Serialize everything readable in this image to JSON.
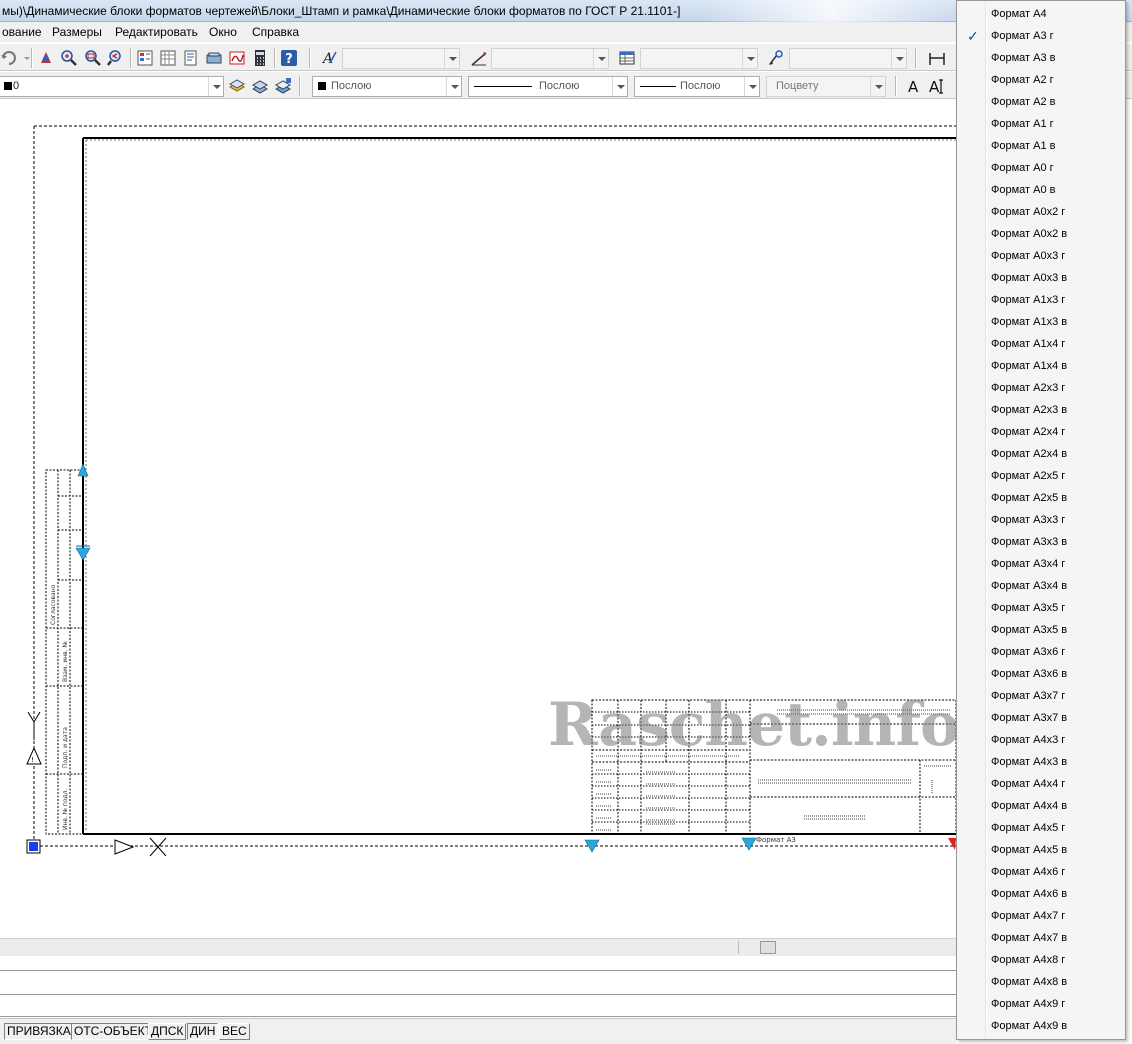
{
  "window": {
    "title": "мы)\\Динамические блоки форматов чертежей\\Блоки_Штамп и рамка\\Динамические блоки форматов по ГОСТ Р 21.1101-]"
  },
  "menu": [
    "ование",
    "Размеры",
    "Редактировать",
    "Окно",
    "Справка"
  ],
  "toolbar2": {
    "layer_value": "0",
    "color_value": "Послою",
    "linetype_value": "Послою",
    "lineweight_value": "Послою",
    "plotstyle_value": "Поцвету"
  },
  "status_buttons": [
    "ПРИВЯЗКА",
    "ОТС-ОБЪЕКТ",
    "ДПСК",
    "ДИН",
    "ВЕС"
  ],
  "watermark": "Raschet.info",
  "dropdown": {
    "selected": "Формат А3 г",
    "items": [
      "Формат А4",
      "Формат А3 г",
      "Формат А3 в",
      "Формат А2 г",
      "Формат А2 в",
      "Формат А1 г",
      "Формат А1 в",
      "Формат А0 г",
      "Формат А0 в",
      "Формат А0х2 г",
      "Формат А0х2 в",
      "Формат А0х3 г",
      "Формат А0х3 в",
      "Формат А1х3 г",
      "Формат А1х3 в",
      "Формат А1х4 г",
      "Формат А1х4 в",
      "Формат А2х3 г",
      "Формат А2х3 в",
      "Формат А2х4 г",
      "Формат А2х4 в",
      "Формат А2х5 г",
      "Формат А2х5 в",
      "Формат А3х3 г",
      "Формат А3х3 в",
      "Формат А3х4 г",
      "Формат А3х4 в",
      "Формат А3х5 г",
      "Формат А3х5 в",
      "Формат А3х6 г",
      "Формат А3х6 в",
      "Формат А3х7 г",
      "Формат А3х7 в",
      "Формат А4х3 г",
      "Формат А4х3 в",
      "Формат А4х4 г",
      "Формат А4х4 в",
      "Формат А4х5 г",
      "Формат А4х5 в",
      "Формат А4х6 г",
      "Формат А4х6 в",
      "Формат А4х7 г",
      "Формат А4х7 в",
      "Формат А4х8 г",
      "Формат А4х8 в",
      "Формат А4х9 г",
      "Формат А4х9 в"
    ]
  },
  "icons": {
    "toolbar1": [
      "undo-icon",
      "pan-icon",
      "zoom-realtime-icon",
      "zoom-window-icon",
      "zoom-previous-icon",
      "properties-icon",
      "design-center-icon",
      "tool-palettes-icon",
      "sheet-set-icon",
      "markup-icon",
      "calculator-icon",
      "help-icon",
      "text-style-icon",
      "dimension-style-icon",
      "table-style-icon",
      "multileader-style-icon"
    ],
    "toolbar2": [
      "layer-properties-icon",
      "layer-previous-icon",
      "layer-states-icon",
      "text-a-icon",
      "text-ai-icon"
    ]
  }
}
